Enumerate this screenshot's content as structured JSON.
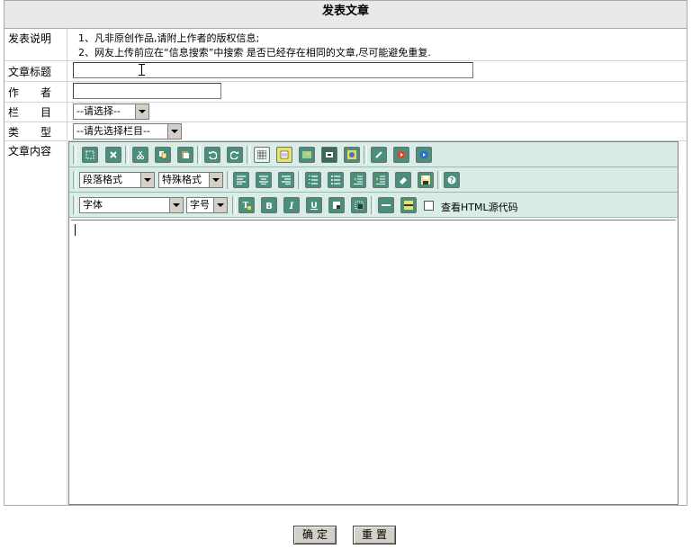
{
  "page": {
    "title": "发表文章"
  },
  "form": {
    "notes": {
      "label": "发表说明",
      "lines": [
        "1、凡非原创作品,请附上作者的版权信息;",
        "2、网友上传前应在“信息搜索”中搜索 是否已经存在相同的文章,尽可能避免重复."
      ]
    },
    "article_title": {
      "label": "文章标题",
      "value": ""
    },
    "author": {
      "label": "作　　者",
      "value": ""
    },
    "column": {
      "label": "栏　　目",
      "selected": "--请选择--"
    },
    "type": {
      "label": "类　　型",
      "selected": "--请先选择栏目--"
    },
    "content": {
      "label": "文章内容",
      "value": ""
    }
  },
  "editor": {
    "row1_icons": [
      "select-all-icon",
      "delete-icon",
      "cut-icon",
      "copy-icon",
      "paste-icon",
      "undo-icon",
      "redo-icon",
      "table-icon",
      "form-icon",
      "image-icon",
      "media-icon",
      "flash-icon",
      "link-icon",
      "realplayer-icon",
      "windows-media-icon"
    ],
    "row2": {
      "paragraph_format": "段落格式",
      "special_format": "特殊格式",
      "icons": [
        "align-left-icon",
        "align-center-icon",
        "align-right-icon",
        "ordered-list-icon",
        "unordered-list-icon",
        "outdent-icon",
        "indent-icon",
        "eraser-icon",
        "save-icon",
        "help-icon"
      ]
    },
    "row3": {
      "font": "字体",
      "font_size": "字号",
      "icons": [
        "text-color-icon",
        "bold-icon",
        "italic-icon",
        "underline-icon",
        "background-color-icon",
        "border-icon",
        "horizontal-rule-icon",
        "marquee-icon"
      ],
      "view_source_label": "查看HTML源代码",
      "view_source_checked": false
    }
  },
  "actions": {
    "submit": "确定",
    "reset": "重置"
  },
  "colors": {
    "toolbar_bg": "#d8ede7",
    "icon_bg": "#4a8f7c",
    "header_bg": "#e8e8e8"
  }
}
